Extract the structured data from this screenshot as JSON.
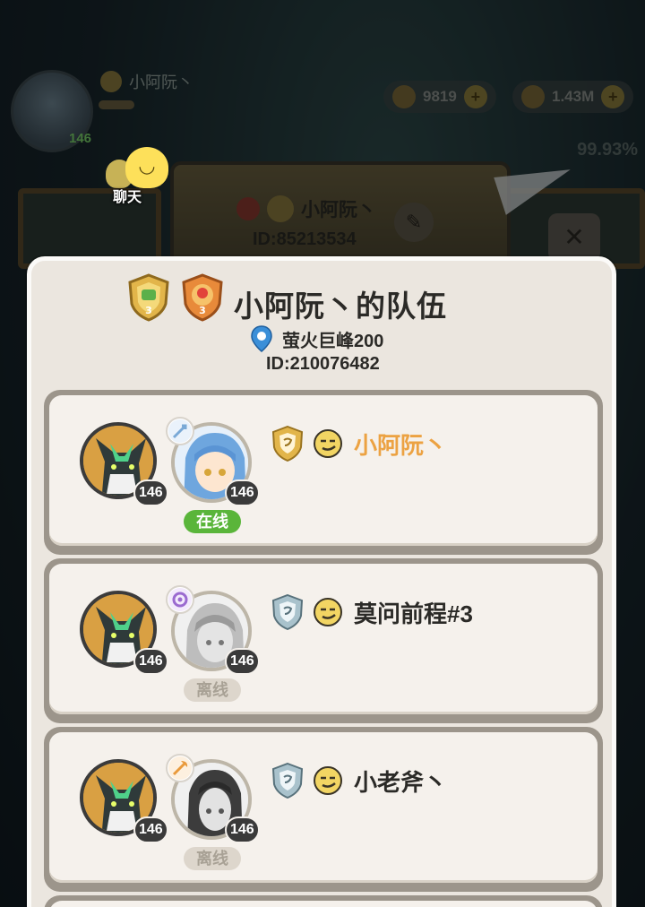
{
  "background": {
    "player_name": "小阿阮丶",
    "player_level": "146",
    "currency_1": "9819",
    "currency_2": "1.43M",
    "progress_pct": "99.93%",
    "chat_label": "聊天",
    "book_player_name": "小阿阮丶",
    "book_player_id": "ID:85213534",
    "close_glyph": "✕"
  },
  "team": {
    "title": "小阿阮丶的队伍",
    "location": "萤火巨峰200",
    "id": "ID:210076482"
  },
  "members": [
    {
      "name": "小阿阮丶",
      "pet_level": "146",
      "hero_level": "146",
      "status": "在线",
      "online": true,
      "rank": "gold",
      "is_self": true,
      "class_color": "#7aa9d6"
    },
    {
      "name": "莫问前程#3",
      "pet_level": "146",
      "hero_level": "146",
      "status": "离线",
      "online": false,
      "rank": "silver",
      "is_self": false,
      "class_color": "#9b6ad0"
    },
    {
      "name": "小老斧丶",
      "pet_level": "146",
      "hero_level": "146",
      "status": "离线",
      "online": false,
      "rank": "silver",
      "is_self": false,
      "class_color": "#e99a3c"
    }
  ],
  "colors": {
    "panel_bg": "#ebe6df",
    "self_name": "#eca242",
    "online": "#5ab53a",
    "offline_text": "#a8a195"
  }
}
